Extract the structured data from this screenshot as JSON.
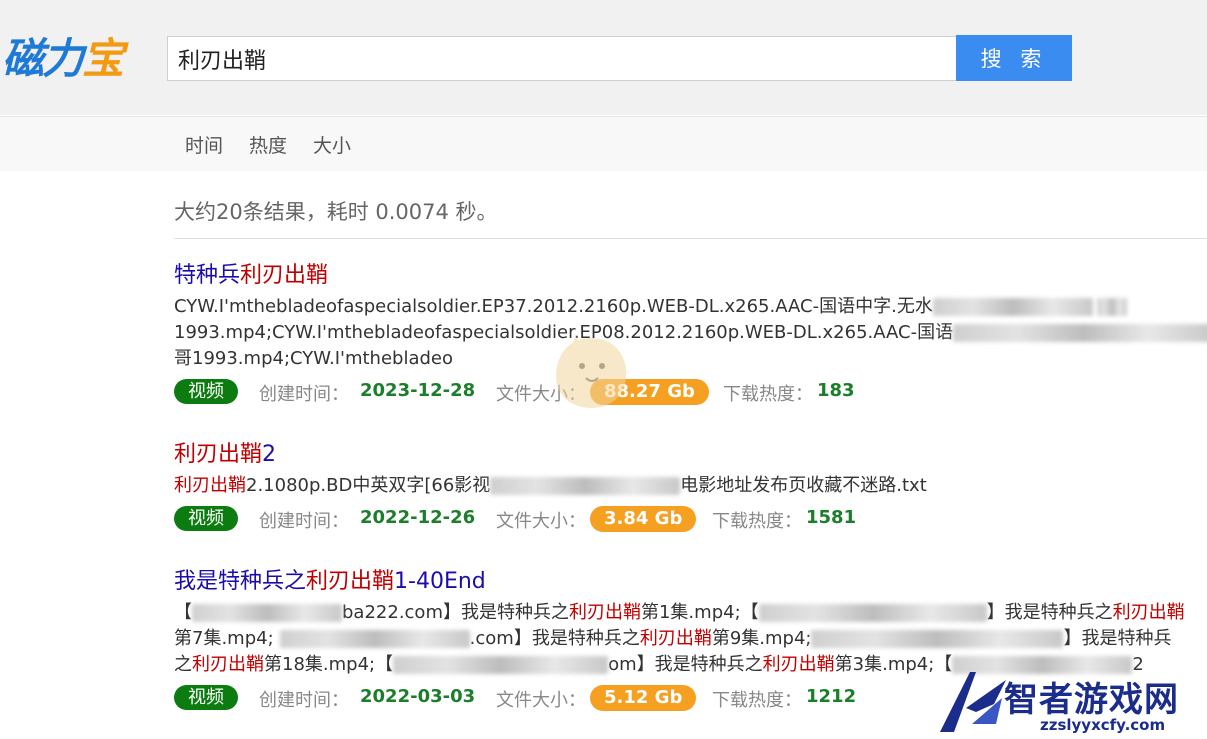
{
  "header": {
    "logo_chars": [
      "磁",
      "力",
      "宝"
    ],
    "search_value": "利刃出鞘",
    "search_button": "搜 索"
  },
  "sort": {
    "items": [
      "时间",
      "热度",
      "大小"
    ]
  },
  "stats": "大约20条结果，耗时 0.0074 秒。",
  "meta_labels": {
    "created": "创建时间：",
    "size": "文件大小：",
    "hot": "下载热度："
  },
  "results": [
    {
      "title_pre": "特种兵",
      "title_hl": "利刃出鞘",
      "title_post": "",
      "desc_line1_a": "CYW.I'mthebladeofaspecialsoldier.EP37.2012.2160p.WEB-DL.x265.AAC-国语中字.无水",
      "desc_line1_b": "",
      "desc_line2_a": "1993.mp4;CYW.I'mthebladeofaspecialsoldier.EP08.2012.2160p.WEB-DL.x265.AAC-国语",
      "desc_line2_b": "",
      "desc_line3": "哥1993.mp4;CYW.I'mthebladeo",
      "badge": "视频",
      "date": "2023-12-28",
      "size": "88.27 Gb",
      "hot": "183"
    },
    {
      "title_pre": "",
      "title_hl": "利刃出鞘",
      "title_post": "2",
      "desc_hl": "利刃出鞘",
      "desc_a": "2.1080p.BD中英双字[66影视",
      "desc_b": "电影地址发布页收藏不迷路.txt",
      "badge": "视频",
      "date": "2022-12-26",
      "size": "3.84 Gb",
      "hot": "1581"
    },
    {
      "title_pre": "我是特种兵之",
      "title_hl": "利刃出鞘",
      "title_post": "1-40End",
      "l1_a": "【",
      "l1_b": "ba222.com】我是特种兵之",
      "l1_hl": "利刃出鞘",
      "l1_c": "第1集.mp4;【",
      "l1_d": "】我是特种兵之",
      "l1_hl2": "利刃出鞘",
      "l2_a": "第7集.mp4;",
      "l2_b": ".com】我是特种兵之",
      "l2_hl": "利刃出鞘",
      "l2_c": "第9集.mp4;",
      "l2_d": "】我是特种兵",
      "l3_a": "之",
      "l3_hl": "利刃出鞘",
      "l3_b": "第18集.mp4;【",
      "l3_c": "om】我是特种兵之",
      "l3_hl2": "利刃出鞘",
      "l3_d": "第3集.mp4;【",
      "l3_e": "2",
      "badge": "视频",
      "date": "2022-03-03",
      "size": "5.12 Gb",
      "hot": "1212"
    }
  ],
  "watermark": {
    "text": "智者游戏网",
    "url": "zzslyyxcfy.com"
  }
}
